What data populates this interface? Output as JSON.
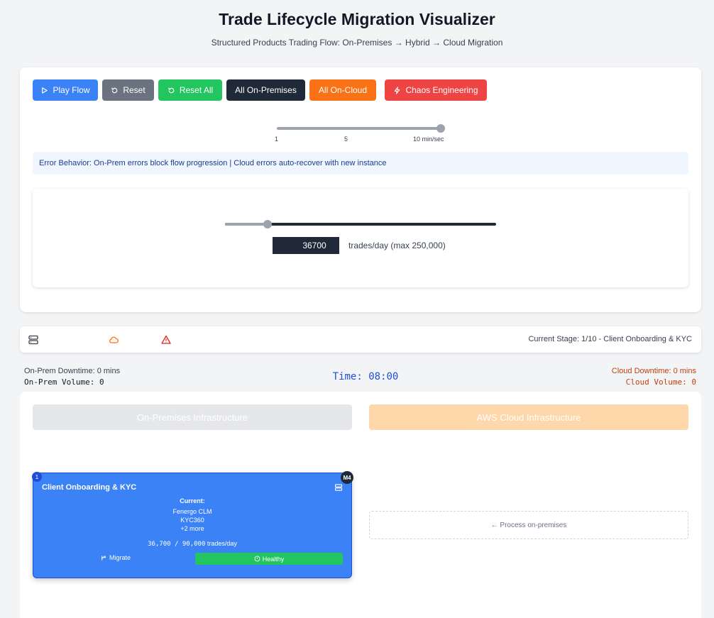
{
  "header": {
    "title": "Trade Lifecycle Migration Visualizer",
    "subtitle": "Structured Products Trading Flow: On-Premises → Hybrid → Cloud Migration"
  },
  "controls": {
    "buttons": {
      "play": "Play Flow",
      "reset": "Reset",
      "reset_all": "Reset All",
      "all_onprem": "All On-Premises",
      "all_cloud": "All On-Cloud",
      "chaos": "Chaos Engineering"
    },
    "colors": {
      "play": "#3b82f6",
      "reset": "#6b7280",
      "reset_all": "#22c55e",
      "all_onprem": "#1f2937",
      "all_cloud": "#f97316",
      "chaos": "#ef4444"
    },
    "speed": {
      "value": 10,
      "min": 1,
      "max": 10,
      "ticks": [
        "1",
        "5",
        "10 min/sec"
      ]
    },
    "error_behavior": "Error Behavior: On-Prem errors block flow progression | Cloud errors auto-recover with new instance"
  },
  "volume": {
    "value": "36700",
    "value_number": 36700,
    "max_number": 250000,
    "label": "trades/day (max 250,000)"
  },
  "status": {
    "icons": [
      "server-icon",
      "cloud-icon",
      "alert-triangle-icon"
    ],
    "stage": "Current Stage: 1/10 - Client Onboarding & KYC"
  },
  "metrics": {
    "onprem_downtime": "On-Prem Downtime: 0 mins",
    "onprem_volume": "On-Prem Volume: 0",
    "time": "Time: 08:00",
    "cloud_downtime": "Cloud Downtime: 0 mins",
    "cloud_volume": "Cloud Volume: 0"
  },
  "infrastructure": {
    "onprem_title": "On-Premises Infrastructure",
    "cloud_title": "AWS Cloud Infrastructure"
  },
  "stage_card": {
    "number": "1",
    "badge": "M4",
    "title": "Client Onboarding & KYC",
    "current_label": "Current:",
    "systems": [
      "Fenergo CLM",
      "KYC360",
      "+2 more"
    ],
    "throughput_value": "36,700 / 90,000",
    "throughput_unit": " trades/day",
    "migrate_label": "Migrate",
    "health_label": "Healthy",
    "health_color": "#22c55e"
  },
  "cloud_placeholder": "← Process on-premises"
}
